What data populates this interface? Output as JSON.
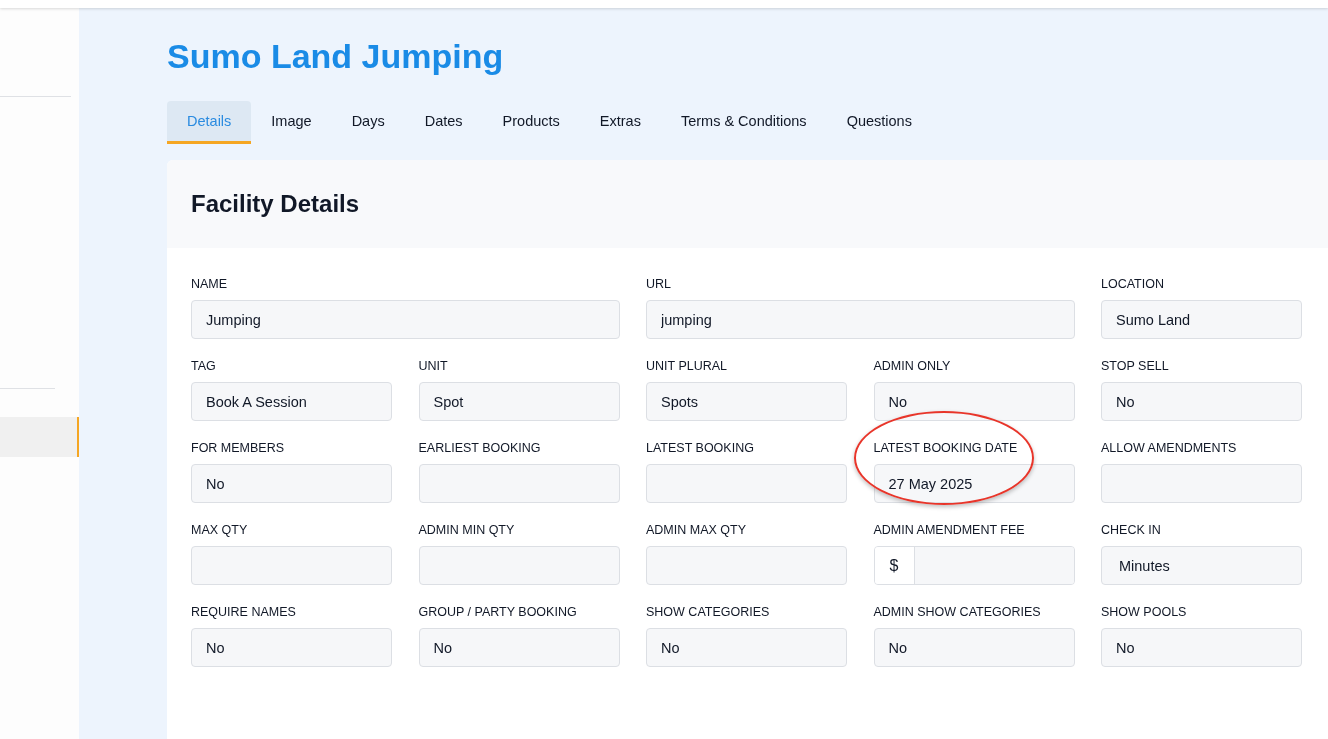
{
  "sidebar": {
    "items": [
      {
        "selected": true
      }
    ]
  },
  "title": "Sumo Land Jumping",
  "tabs": [
    {
      "label": "Details",
      "selected": true
    },
    {
      "label": "Image",
      "selected": false
    },
    {
      "label": "Days",
      "selected": false
    },
    {
      "label": "Dates",
      "selected": false
    },
    {
      "label": "Products",
      "selected": false
    },
    {
      "label": "Extras",
      "selected": false
    },
    {
      "label": "Terms & Conditions",
      "selected": false
    },
    {
      "label": "Questions",
      "selected": false
    }
  ],
  "card": {
    "heading": "Facility Details",
    "fields": [
      {
        "label": "NAME",
        "value": "Jumping",
        "kind": "wide",
        "highlighted": false
      },
      {
        "label": "URL",
        "value": "jumping",
        "kind": "wide",
        "highlighted": false
      },
      {
        "label": "LOCATION",
        "value": "Sumo Land",
        "kind": "text",
        "highlighted": false
      },
      {
        "label": "TAG",
        "value": "Book A Session",
        "kind": "text",
        "highlighted": false
      },
      {
        "label": "UNIT",
        "value": "Spot",
        "kind": "text",
        "highlighted": false
      },
      {
        "label": "UNIT PLURAL",
        "value": "Spots",
        "kind": "text",
        "highlighted": false
      },
      {
        "label": "ADMIN ONLY",
        "value": "No",
        "kind": "text",
        "highlighted": false
      },
      {
        "label": "STOP SELL",
        "value": "No",
        "kind": "text",
        "highlighted": false
      },
      {
        "label": "FOR MEMBERS",
        "value": "No",
        "kind": "text",
        "highlighted": false
      },
      {
        "label": "EARLIEST BOOKING",
        "kind": "text",
        "highlighted": false
      },
      {
        "label": "LATEST BOOKING",
        "kind": "text",
        "highlighted": false
      },
      {
        "label": "LATEST BOOKING DATE",
        "value": "27 May 2025",
        "kind": "text",
        "highlighted": true
      },
      {
        "label": "ALLOW AMENDMENTS",
        "kind": "text",
        "highlighted": false
      },
      {
        "label": "MAX QTY",
        "kind": "text",
        "highlighted": false
      },
      {
        "label": "ADMIN MIN QTY",
        "kind": "text",
        "highlighted": false
      },
      {
        "label": "ADMIN MAX QTY",
        "kind": "text",
        "highlighted": false
      },
      {
        "label": "ADMIN AMENDMENT FEE",
        "prefix": "$",
        "kind": "currency",
        "highlighted": false
      },
      {
        "label": "CHECK IN",
        "value": "Minutes",
        "kind": "select",
        "highlighted": false
      },
      {
        "label": "REQUIRE NAMES",
        "value": "No",
        "kind": "text",
        "highlighted": false
      },
      {
        "label": "GROUP / PARTY BOOKING",
        "value": "No",
        "kind": "text",
        "highlighted": false
      },
      {
        "label": "SHOW CATEGORIES",
        "value": "No",
        "kind": "text",
        "highlighted": false
      },
      {
        "label": "ADMIN SHOW CATEGORIES",
        "value": "No",
        "kind": "text",
        "highlighted": false
      },
      {
        "label": "SHOW POOLS",
        "value": "No",
        "kind": "text",
        "highlighted": false
      }
    ]
  }
}
